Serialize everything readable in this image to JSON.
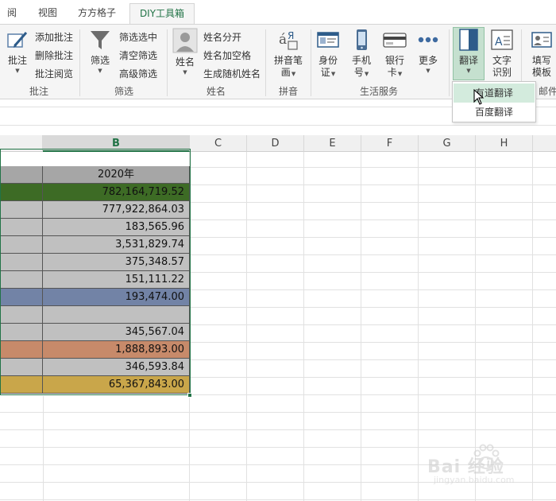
{
  "tabs": [
    {
      "label": "阅"
    },
    {
      "label": "视图"
    },
    {
      "label": "方方格子"
    },
    {
      "label": "DIY工具箱"
    }
  ],
  "ribbon": {
    "annotate": {
      "big_label": "批注",
      "items": [
        "添加批注",
        "删除批注",
        "批注阅览"
      ],
      "group_label": "批注"
    },
    "filter": {
      "big_label": "筛选",
      "items": [
        "筛选选中",
        "清空筛选",
        "高级筛选"
      ],
      "group_label": "筛选"
    },
    "name": {
      "big_label": "姓名",
      "items": [
        "姓名分开",
        "姓名加空格",
        "生成随机姓名"
      ],
      "group_label": "姓名"
    },
    "pinyin": {
      "big_label_1": "拼音笔",
      "big_label_2": "画",
      "group_label": "拼音"
    },
    "life": {
      "idcard_1": "身份",
      "idcard_2": "证",
      "phone_1": "手机",
      "phone_2": "号",
      "bank_1": "银行",
      "bank_2": "卡",
      "more": "更多",
      "group_label": "生活服务"
    },
    "translate": {
      "label": "翻译"
    },
    "ocr": {
      "label_1": "文字",
      "label_2": "识别"
    },
    "fill": {
      "label_1": "填写",
      "label_2": "模板",
      "group_label_partial": "邮件"
    }
  },
  "dropdown": {
    "items": [
      "有道翻译",
      "百度翻译"
    ]
  },
  "columns": [
    "B",
    "C",
    "D",
    "E",
    "F",
    "G",
    "H"
  ],
  "table": {
    "header": "2020年",
    "rows": [
      {
        "value": "782,164,719.52",
        "color": "#3d6b25"
      },
      {
        "value": "777,922,864.03",
        "color": "#c0c0c0"
      },
      {
        "value": "183,565.96",
        "color": "#c0c0c0"
      },
      {
        "value": "3,531,829.74",
        "color": "#c0c0c0"
      },
      {
        "value": "375,348.57",
        "color": "#c0c0c0"
      },
      {
        "value": "151,111.22",
        "color": "#c0c0c0"
      },
      {
        "value": "193,474.00",
        "color": "#7283a6"
      },
      {
        "value": "",
        "color": "#c0c0c0"
      },
      {
        "value": "345,567.04",
        "color": "#c0c0c0"
      },
      {
        "value": "1,888,893.00",
        "color": "#c78a6a"
      },
      {
        "value": "346,593.84",
        "color": "#c0c0c0"
      },
      {
        "value": "65,367,843.00",
        "color": "#c9a64a"
      }
    ],
    "header_color": "#a6a6a6"
  },
  "watermark": {
    "brand": "Bai 经验",
    "url": "jingyan.baidu.com"
  },
  "colors": {
    "accent": "#217346",
    "ribbon_bg": "#f5f5f5",
    "active_button": "#c5e0cf"
  }
}
